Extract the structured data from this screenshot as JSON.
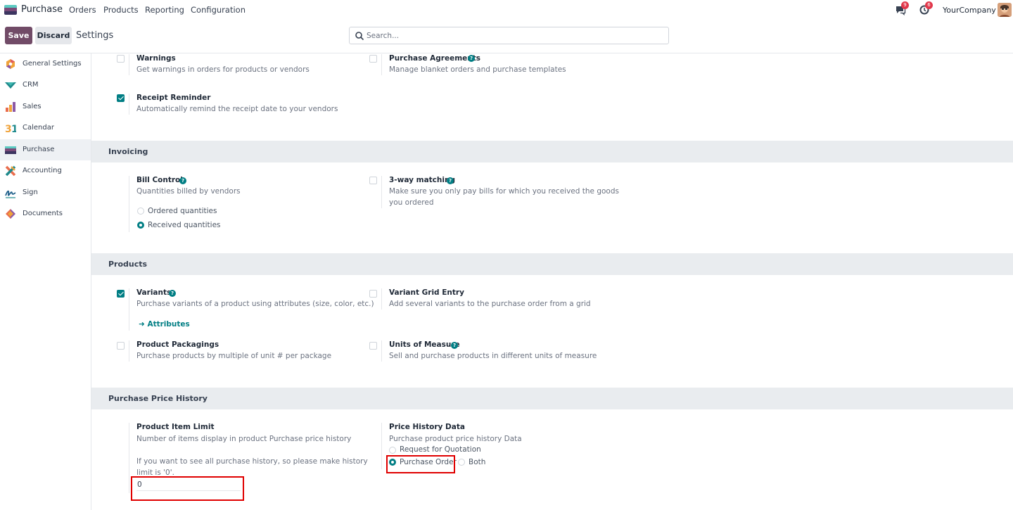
{
  "nav": {
    "app_name": "Purchase",
    "menu": [
      "Orders",
      "Products",
      "Reporting",
      "Configuration"
    ],
    "messages_count": "9",
    "activities_count": "6",
    "company": "YourCompany"
  },
  "control_panel": {
    "save_label": "Save",
    "discard_label": "Discard",
    "title": "Settings",
    "search_placeholder": "Search..."
  },
  "sidebar": {
    "items": [
      {
        "label": "General Settings",
        "icon": "general-settings-icon"
      },
      {
        "label": "CRM",
        "icon": "crm-icon"
      },
      {
        "label": "Sales",
        "icon": "sales-icon"
      },
      {
        "label": "Calendar",
        "icon": "calendar-icon"
      },
      {
        "label": "Purchase",
        "icon": "purchase-icon",
        "active": true
      },
      {
        "label": "Accounting",
        "icon": "accounting-icon"
      },
      {
        "label": "Sign",
        "icon": "sign-icon"
      },
      {
        "label": "Documents",
        "icon": "documents-icon"
      }
    ]
  },
  "orders_section": {
    "warnings": {
      "title": "Warnings",
      "desc": "Get warnings in orders for products or vendors",
      "checked": false
    },
    "agreements": {
      "title": "Purchase Agreements",
      "desc": "Manage blanket orders and purchase templates",
      "checked": false
    },
    "receipt_reminder": {
      "title": "Receipt Reminder",
      "desc": "Automatically remind the receipt date to your vendors",
      "checked": true
    }
  },
  "invoicing": {
    "header": "Invoicing",
    "bill_control": {
      "title": "Bill Control",
      "desc": "Quantities billed by vendors",
      "options": [
        "Ordered quantities",
        "Received quantities"
      ],
      "selected": "Received quantities"
    },
    "three_way": {
      "title": "3-way matching",
      "desc_line1": "Make sure you only pay bills for which you received the goods",
      "desc_line2": "you ordered",
      "checked": false
    }
  },
  "products": {
    "header": "Products",
    "variants": {
      "title": "Variants",
      "desc": "Purchase variants of a product using attributes (size, color, etc.)",
      "checked": true,
      "link": "Attributes"
    },
    "variant_grid": {
      "title": "Variant Grid Entry",
      "desc": "Add several variants to the purchase order from a grid",
      "checked": false
    },
    "packagings": {
      "title": "Product Packagings",
      "desc": "Purchase products by multiple of unit # per package",
      "checked": false
    },
    "uom": {
      "title": "Units of Measure",
      "desc": "Sell and purchase products in different units of measure",
      "checked": false
    }
  },
  "price_history": {
    "header": "Purchase Price History",
    "item_limit": {
      "title": "Product Item Limit",
      "desc": "Number of items display in product Purchase price history",
      "note_line1": "If you want to see all purchase history, so please make history",
      "note_line2": "limit is '0'.",
      "value": "0"
    },
    "history_data": {
      "title": "Price History Data",
      "desc": "Purchase product price history Data",
      "options": [
        "Request for Quotation",
        "Purchase Order",
        "Both"
      ],
      "selected": "Purchase Order"
    }
  },
  "colors": {
    "brand": "#714b67",
    "accent": "#017e84",
    "highlight": "#e00000"
  }
}
